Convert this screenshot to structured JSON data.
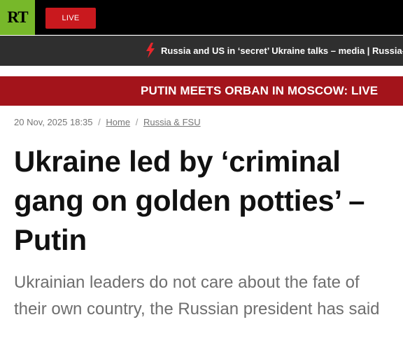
{
  "header": {
    "logo_text": "RT",
    "logo_color": "#77b82a",
    "live_label": "LIVE",
    "live_color": "#c9191e"
  },
  "ticker": {
    "icon": "lightning-bolt-icon",
    "text": "Russia and US in ‘secret’ Ukraine talks – media | Russia-U"
  },
  "banner": {
    "text": "PUTIN MEETS ORBAN IN MOSCOW: LIVE",
    "color": "#a3141b"
  },
  "article": {
    "date": "20 Nov, 2025 18:35",
    "breadcrumb": [
      "Home",
      "Russia & FSU"
    ],
    "title": "Ukraine led by ‘criminal gang on golden potties’ – Putin",
    "summary": "Ukrainian leaders do not care about the fate of their own country, the Russian president has said"
  }
}
